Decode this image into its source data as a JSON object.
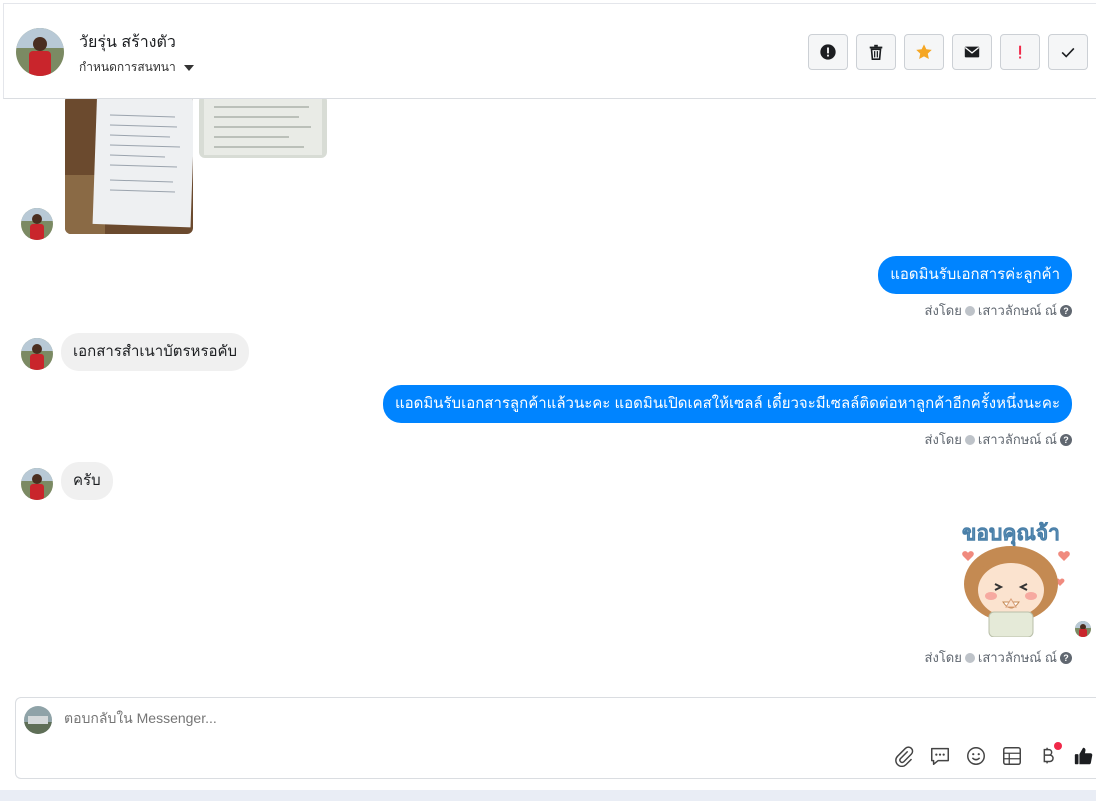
{
  "header": {
    "contact_name": "วัยรุ่น สร้างตัว",
    "assign_label": "กำหนดการสนทนา",
    "actions": [
      {
        "icon": "alert-circle-icon",
        "name": "spam-button"
      },
      {
        "icon": "trash-icon",
        "name": "delete-button"
      },
      {
        "icon": "star-icon",
        "name": "star-button"
      },
      {
        "icon": "mail-icon",
        "name": "mark-unread-button"
      },
      {
        "icon": "exclamation-icon",
        "name": "follow-up-button"
      },
      {
        "icon": "check-icon",
        "name": "done-button"
      }
    ]
  },
  "messages": {
    "out1": "แอดมินรับเอกสารค่ะลูกค้า",
    "in1": "เอกสารสำเนาบัตรหรอคับ",
    "out2": "แอดมินรับเอกสารลูกค้าแล้วนะคะ แอดมินเปิดเคสให้เซลล์ เดี๋ยวจะมีเซลล์ติดต่อหาลูกค้าอีกครั้งหนึ่งนะคะ",
    "in2": "ครับ",
    "sticker_text": "ขอบคุณจ้า"
  },
  "sent_by": {
    "prefix": "ส่งโดย",
    "agent": "เสาวลักษณ์ ณ์",
    "help": "?"
  },
  "composer": {
    "placeholder": "ตอบกลับใน Messenger...",
    "tools": [
      "attach-icon",
      "saved-reply-icon",
      "emoji-icon",
      "form-icon",
      "baht-icon",
      "like-icon"
    ]
  },
  "colors": {
    "outgoing_bubble": "#0084ff",
    "incoming_bubble": "#f0f0f0",
    "star": "#f5a623",
    "exclamation": "#f02849"
  }
}
